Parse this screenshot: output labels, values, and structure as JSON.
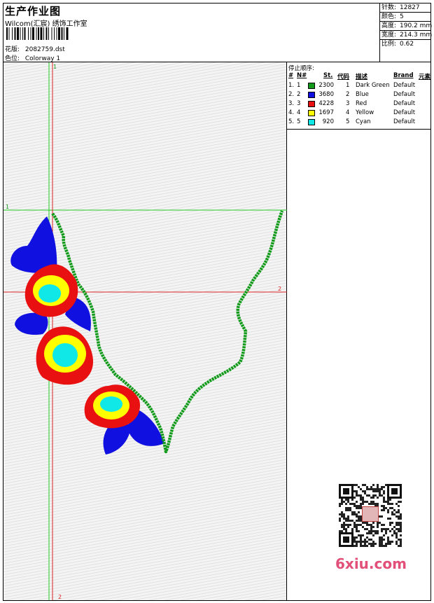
{
  "header": {
    "title": "生产作业图",
    "company": "Wilcom(汇宸) 绣饰工作室",
    "design": {
      "label": "花版:",
      "value": "2082759.dst"
    },
    "colorway": {
      "label": "色位:",
      "value": "Colorway 1"
    }
  },
  "stats": [
    {
      "label": "针数:",
      "value": "12827"
    },
    {
      "label": "颜色:",
      "value": "5"
    },
    {
      "label": "高度:",
      "value": "190.2 mm"
    },
    {
      "label": "宽度:",
      "value": "214.3 mm"
    },
    {
      "label": "比例:",
      "value": "0.62"
    }
  ],
  "legend": {
    "title": "停止顺序:",
    "headers": {
      "hash": "#",
      "no": "N#",
      "st": "St.",
      "code": "代码",
      "desc": "描述",
      "brand": "Brand",
      "elem": "元素"
    },
    "rows": [
      {
        "num": "1.",
        "n": "1",
        "color": "#129a1a",
        "stitches": "2300",
        "code": "1",
        "desc": "Dark Green",
        "brand": "Default"
      },
      {
        "num": "2.",
        "n": "2",
        "color": "#1010e0",
        "stitches": "3680",
        "code": "2",
        "desc": "Blue",
        "brand": "Default"
      },
      {
        "num": "3.",
        "n": "3",
        "color": "#e81010",
        "stitches": "4228",
        "code": "3",
        "desc": "Red",
        "brand": "Default"
      },
      {
        "num": "4.",
        "n": "4",
        "color": "#ffff00",
        "stitches": "1697",
        "code": "4",
        "desc": "Yellow",
        "brand": "Default"
      },
      {
        "num": "5.",
        "n": "5",
        "color": "#10e8e8",
        "stitches": "920",
        "code": "5",
        "desc": "Cyan",
        "brand": "Default"
      }
    ]
  },
  "guides": {
    "v1": "1",
    "h1": "1",
    "h2": "2",
    "v2": "2"
  },
  "watermark": {
    "stamp": "回回 回回",
    "site": "6xiu.com"
  },
  "colors": {
    "green": "#129a1a",
    "blue": "#1010e0",
    "red": "#e81010",
    "yellow": "#ffff00",
    "cyan": "#10e8e8",
    "guide_green": "#22cc22",
    "guide_red": "#dd2222"
  }
}
